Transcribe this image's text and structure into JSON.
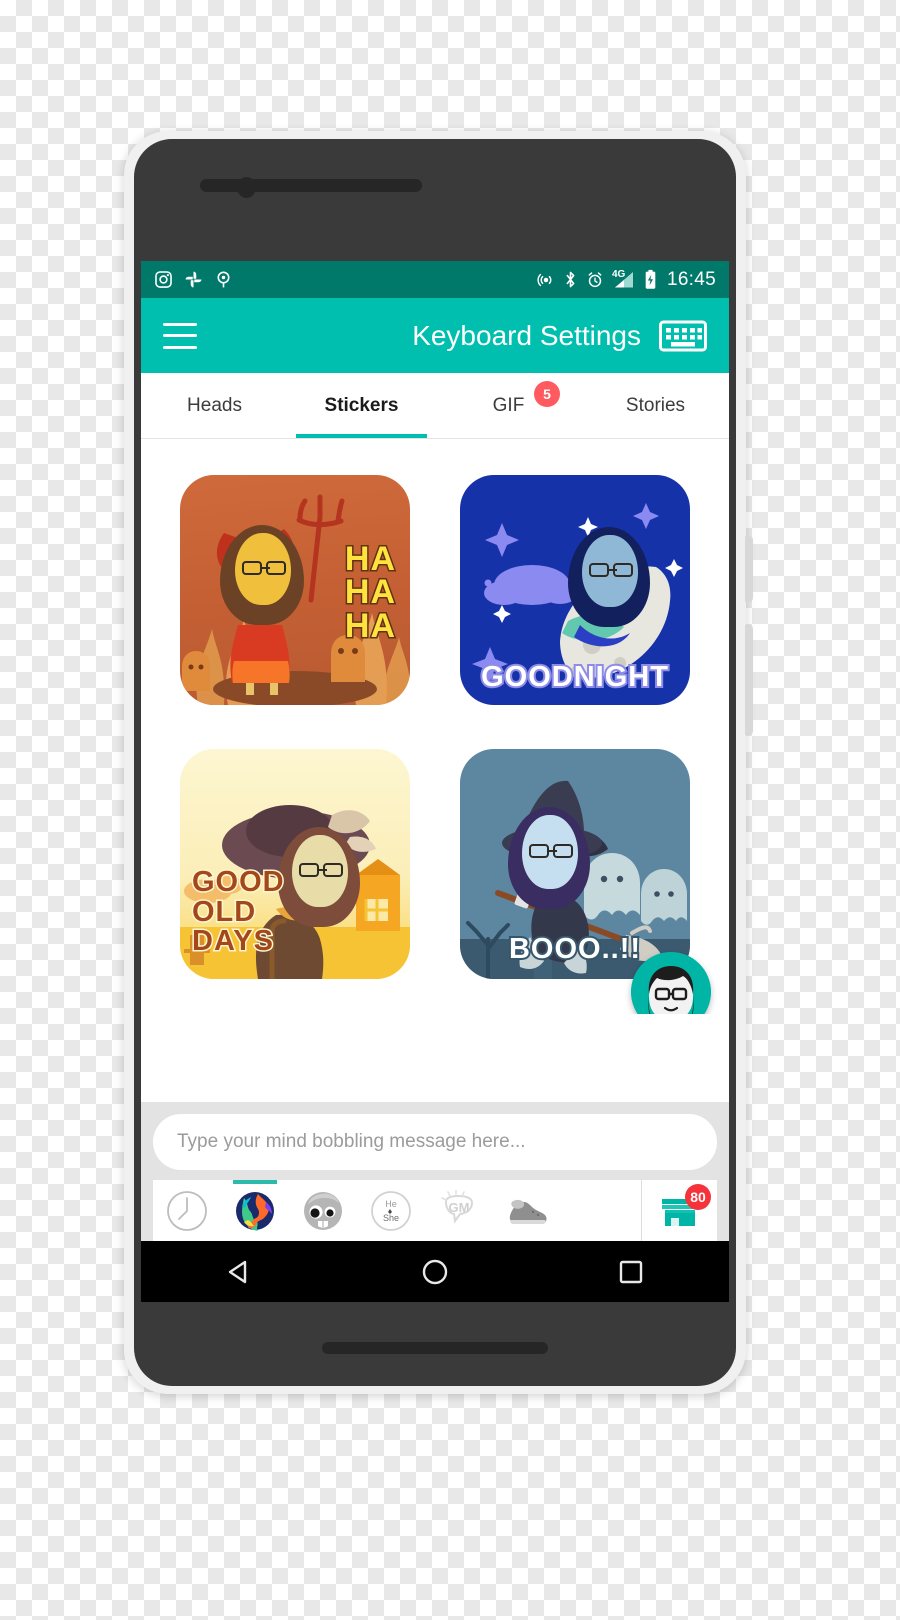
{
  "device": {
    "frame_name": "android-phone-mockup",
    "background": "transparent-checkerboard"
  },
  "status_bar": {
    "background_color": "#00796b",
    "time": "16:45",
    "left_icons": [
      "instagram-icon",
      "google-photos-icon",
      "pocket-icon"
    ],
    "right_icons": [
      "hotspot-icon",
      "bluetooth-icon",
      "alarm-icon",
      "signal-4g-icon",
      "battery-charging-icon"
    ],
    "network_label": "4G"
  },
  "app_bar": {
    "background_color": "#00bfae",
    "menu_label": "menu-icon",
    "title": "Keyboard Settings",
    "action_icon": "keyboard-icon"
  },
  "tabs": {
    "items": [
      {
        "label": "Heads",
        "active": false,
        "badge": ""
      },
      {
        "label": "Stickers",
        "active": true,
        "badge": ""
      },
      {
        "label": "GIF",
        "active": false,
        "badge": "5"
      },
      {
        "label": "Stories",
        "active": false,
        "badge": ""
      }
    ],
    "indicator_color": "#00bfae",
    "badge_color": "#ff5a5f"
  },
  "stickers": [
    {
      "id": "devil-haha",
      "caption": "HA\nHA\nHA",
      "theme": "devil",
      "art_class": "art-devil"
    },
    {
      "id": "goodnight-moon",
      "caption": "GOODNIGHT",
      "theme": "night",
      "art_class": "art-night"
    },
    {
      "id": "good-old-days",
      "caption": "GOOD\nOLD\nDAYS",
      "theme": "vintage",
      "art_class": "art-old"
    },
    {
      "id": "witch-booo",
      "caption": "BOOO..!!",
      "theme": "halloween",
      "art_class": "art-boo"
    },
    {
      "id": "sunshine",
      "caption": "",
      "theme": "sun",
      "art_class": "art-sun"
    },
    {
      "id": "stage-music",
      "caption": "",
      "theme": "concert",
      "art_class": "art-stage"
    }
  ],
  "fab": {
    "name": "avatar-fab",
    "background_color": "#00b5a5"
  },
  "keyboard": {
    "input_placeholder": "Type your mind bobbling message here...",
    "input_value": "",
    "toolbar": [
      {
        "icon": "recent-clock-icon",
        "label": "Recent",
        "active": false
      },
      {
        "icon": "globe-world-icon",
        "label": "World",
        "active": true
      },
      {
        "icon": "monster-face-icon",
        "label": "Monster",
        "active": false
      },
      {
        "icon": "he-she-icon",
        "label": "He She",
        "active": false
      },
      {
        "icon": "gm-bubble-icon",
        "label": "GM",
        "active": false
      },
      {
        "icon": "sneaker-icon",
        "label": "Shoe",
        "active": false
      }
    ],
    "store": {
      "icon": "store-icon",
      "badge": "80",
      "badge_color": "#f6323a"
    },
    "active_indicator_color": "#2bbbad"
  },
  "nav_bar": {
    "background_color": "#000000",
    "buttons": [
      "back-triangle-icon",
      "home-circle-icon",
      "recents-square-icon"
    ]
  }
}
